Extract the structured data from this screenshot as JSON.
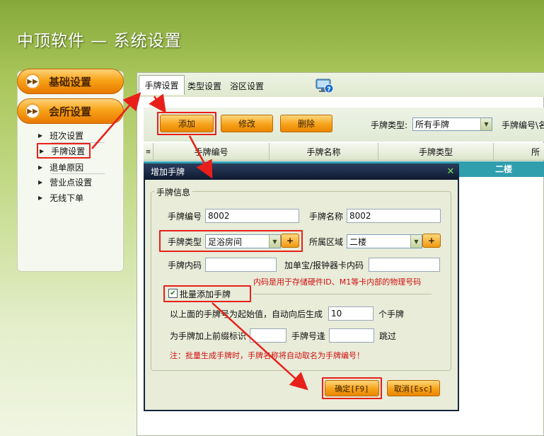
{
  "app": {
    "title": "中顶软件 — 系统设置"
  },
  "sidebar": {
    "categories": [
      {
        "label": "基础设置"
      },
      {
        "label": "会所设置"
      }
    ],
    "items": [
      {
        "label": "班次设置"
      },
      {
        "label": "手牌设置"
      },
      {
        "label": "退单原因"
      },
      {
        "label": "营业点设置"
      },
      {
        "label": "无线下单"
      }
    ]
  },
  "tabs": [
    {
      "label": "手牌设置"
    },
    {
      "label": "类型设置"
    },
    {
      "label": "浴区设置"
    }
  ],
  "toolbar": {
    "add_label": "添加",
    "edit_label": "修改",
    "delete_label": "删除",
    "type_filter_label": "手牌类型:",
    "type_filter_value": "所有手牌",
    "search_label": "手牌编号\\名"
  },
  "grid": {
    "columns": [
      "手牌编号",
      "手牌名称",
      "手牌类型",
      "所"
    ],
    "row_area_value": "二楼"
  },
  "dialog": {
    "title": "增加手牌",
    "close_glyph": "✕",
    "group_title": "手牌信息",
    "fields": {
      "code_label": "手牌编号",
      "code_value": "8002",
      "name_label": "手牌名称",
      "name_value": "8002",
      "type_label": "手牌类型",
      "type_value": "足浴房间",
      "area_label": "所属区域",
      "area_value": "二楼",
      "inner_code_label": "手牌内码",
      "inner_code_value": "",
      "card_code_label": "加单宝/报钟器卡内码",
      "card_code_value": "",
      "inner_code_note": "内码是用于存储硬件ID、M1等卡内部的物理号码",
      "plus_glyph": "+"
    },
    "batch": {
      "checkbox_label": "批量添加手牌",
      "checked": true,
      "auto_gen_label": "以上面的手牌号为起始值，自动向后生成",
      "count_value": "10",
      "count_suffix": "个手牌",
      "prefix_label": "为手牌加上前缀标识",
      "prefix_value": "",
      "skip_label": "手牌号逢",
      "skip_value": "",
      "skip_suffix": "跳过",
      "warning": "注：批量生成手牌时，手牌名称将自动取名为手牌编号！"
    },
    "ok_label": "确定[F9]",
    "cancel_label": "取消[Esc]"
  },
  "colors": {
    "accent_orange": "#f6a21a",
    "highlight_red": "#e8201a",
    "dialog_title_bg": "#0e1a30",
    "grid_selected_row": "#2f9fae"
  }
}
